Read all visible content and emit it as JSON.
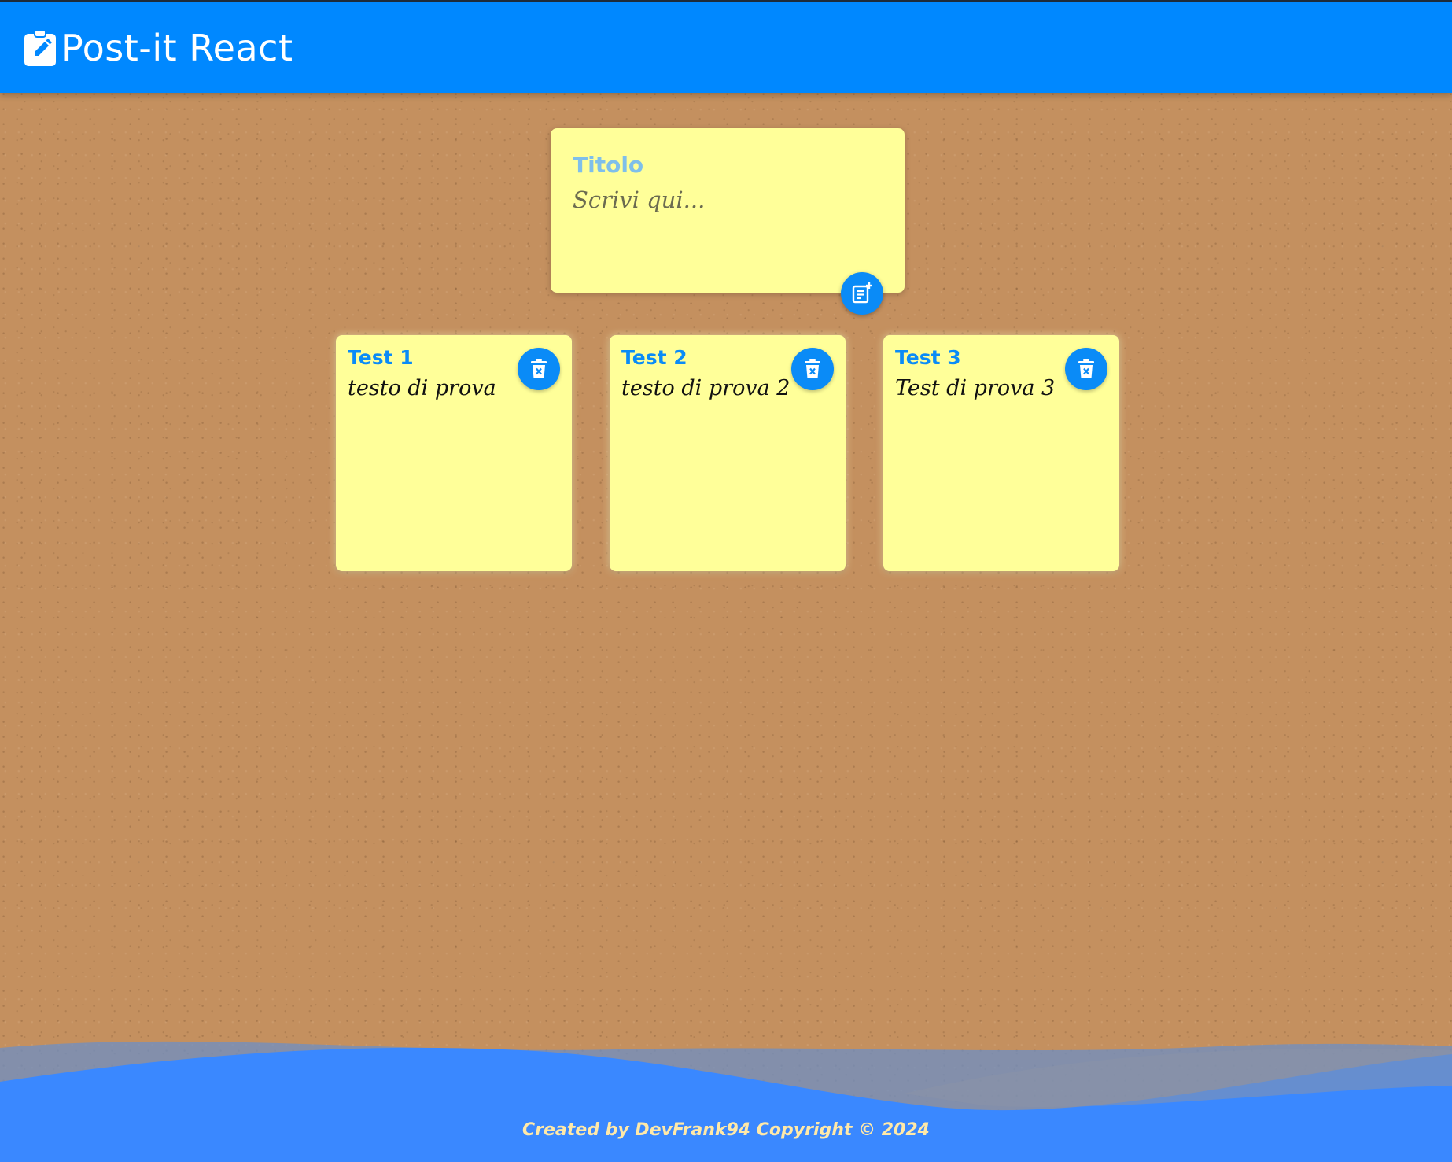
{
  "header": {
    "brand_icon": "clipboard-edit-icon",
    "title": "Post-it React",
    "bg_color": "#0088ff"
  },
  "composer": {
    "title_placeholder": "Titolo",
    "body_placeholder": "Scrivi qui...",
    "add_icon": "note-add-icon",
    "bg_color": "#ffff99"
  },
  "notes": [
    {
      "title": "Test 1",
      "body": "testo di prova",
      "delete_icon": "trash-icon"
    },
    {
      "title": "Test 2",
      "body": "testo di prova 2",
      "delete_icon": "trash-icon"
    },
    {
      "title": "Test 3",
      "body": "Test di prova 3",
      "delete_icon": "trash-icon"
    }
  ],
  "footer": {
    "text": "Created by DevFrank94 Copyright © 2024",
    "bg_color": "#3a88ff"
  },
  "colors": {
    "accent": "#0a8bf7",
    "board": "#c4905f",
    "note": "#ffff99"
  }
}
